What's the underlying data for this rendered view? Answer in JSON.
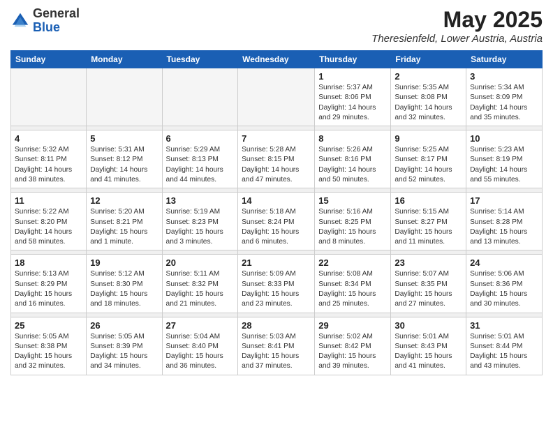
{
  "logo": {
    "general": "General",
    "blue": "Blue"
  },
  "title": "May 2025",
  "subtitle": "Theresienfeld, Lower Austria, Austria",
  "days_of_week": [
    "Sunday",
    "Monday",
    "Tuesday",
    "Wednesday",
    "Thursday",
    "Friday",
    "Saturday"
  ],
  "weeks": [
    {
      "days": [
        {
          "num": "",
          "empty": true
        },
        {
          "num": "",
          "empty": true
        },
        {
          "num": "",
          "empty": true
        },
        {
          "num": "",
          "empty": true
        },
        {
          "num": "1",
          "sunrise": "5:37 AM",
          "sunset": "8:06 PM",
          "daylight": "14 hours and 29 minutes."
        },
        {
          "num": "2",
          "sunrise": "5:35 AM",
          "sunset": "8:08 PM",
          "daylight": "14 hours and 32 minutes."
        },
        {
          "num": "3",
          "sunrise": "5:34 AM",
          "sunset": "8:09 PM",
          "daylight": "14 hours and 35 minutes."
        }
      ]
    },
    {
      "days": [
        {
          "num": "4",
          "sunrise": "5:32 AM",
          "sunset": "8:11 PM",
          "daylight": "14 hours and 38 minutes."
        },
        {
          "num": "5",
          "sunrise": "5:31 AM",
          "sunset": "8:12 PM",
          "daylight": "14 hours and 41 minutes."
        },
        {
          "num": "6",
          "sunrise": "5:29 AM",
          "sunset": "8:13 PM",
          "daylight": "14 hours and 44 minutes."
        },
        {
          "num": "7",
          "sunrise": "5:28 AM",
          "sunset": "8:15 PM",
          "daylight": "14 hours and 47 minutes."
        },
        {
          "num": "8",
          "sunrise": "5:26 AM",
          "sunset": "8:16 PM",
          "daylight": "14 hours and 50 minutes."
        },
        {
          "num": "9",
          "sunrise": "5:25 AM",
          "sunset": "8:17 PM",
          "daylight": "14 hours and 52 minutes."
        },
        {
          "num": "10",
          "sunrise": "5:23 AM",
          "sunset": "8:19 PM",
          "daylight": "14 hours and 55 minutes."
        }
      ]
    },
    {
      "days": [
        {
          "num": "11",
          "sunrise": "5:22 AM",
          "sunset": "8:20 PM",
          "daylight": "14 hours and 58 minutes."
        },
        {
          "num": "12",
          "sunrise": "5:20 AM",
          "sunset": "8:21 PM",
          "daylight": "15 hours and 1 minute."
        },
        {
          "num": "13",
          "sunrise": "5:19 AM",
          "sunset": "8:23 PM",
          "daylight": "15 hours and 3 minutes."
        },
        {
          "num": "14",
          "sunrise": "5:18 AM",
          "sunset": "8:24 PM",
          "daylight": "15 hours and 6 minutes."
        },
        {
          "num": "15",
          "sunrise": "5:16 AM",
          "sunset": "8:25 PM",
          "daylight": "15 hours and 8 minutes."
        },
        {
          "num": "16",
          "sunrise": "5:15 AM",
          "sunset": "8:27 PM",
          "daylight": "15 hours and 11 minutes."
        },
        {
          "num": "17",
          "sunrise": "5:14 AM",
          "sunset": "8:28 PM",
          "daylight": "15 hours and 13 minutes."
        }
      ]
    },
    {
      "days": [
        {
          "num": "18",
          "sunrise": "5:13 AM",
          "sunset": "8:29 PM",
          "daylight": "15 hours and 16 minutes."
        },
        {
          "num": "19",
          "sunrise": "5:12 AM",
          "sunset": "8:30 PM",
          "daylight": "15 hours and 18 minutes."
        },
        {
          "num": "20",
          "sunrise": "5:11 AM",
          "sunset": "8:32 PM",
          "daylight": "15 hours and 21 minutes."
        },
        {
          "num": "21",
          "sunrise": "5:09 AM",
          "sunset": "8:33 PM",
          "daylight": "15 hours and 23 minutes."
        },
        {
          "num": "22",
          "sunrise": "5:08 AM",
          "sunset": "8:34 PM",
          "daylight": "15 hours and 25 minutes."
        },
        {
          "num": "23",
          "sunrise": "5:07 AM",
          "sunset": "8:35 PM",
          "daylight": "15 hours and 27 minutes."
        },
        {
          "num": "24",
          "sunrise": "5:06 AM",
          "sunset": "8:36 PM",
          "daylight": "15 hours and 30 minutes."
        }
      ]
    },
    {
      "days": [
        {
          "num": "25",
          "sunrise": "5:05 AM",
          "sunset": "8:38 PM",
          "daylight": "15 hours and 32 minutes."
        },
        {
          "num": "26",
          "sunrise": "5:05 AM",
          "sunset": "8:39 PM",
          "daylight": "15 hours and 34 minutes."
        },
        {
          "num": "27",
          "sunrise": "5:04 AM",
          "sunset": "8:40 PM",
          "daylight": "15 hours and 36 minutes."
        },
        {
          "num": "28",
          "sunrise": "5:03 AM",
          "sunset": "8:41 PM",
          "daylight": "15 hours and 37 minutes."
        },
        {
          "num": "29",
          "sunrise": "5:02 AM",
          "sunset": "8:42 PM",
          "daylight": "15 hours and 39 minutes."
        },
        {
          "num": "30",
          "sunrise": "5:01 AM",
          "sunset": "8:43 PM",
          "daylight": "15 hours and 41 minutes."
        },
        {
          "num": "31",
          "sunrise": "5:01 AM",
          "sunset": "8:44 PM",
          "daylight": "15 hours and 43 minutes."
        }
      ]
    }
  ]
}
